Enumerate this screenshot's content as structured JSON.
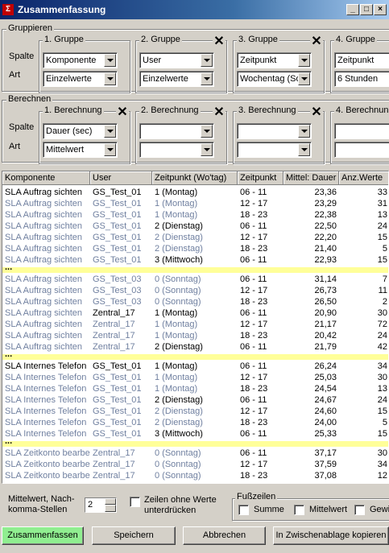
{
  "window": {
    "title": "Zusammenfassung",
    "icon": "app-icon",
    "controls": [
      "_",
      "□",
      "×"
    ]
  },
  "gruppieren": {
    "title": "Gruppieren",
    "row_labels": [
      "Spalte",
      "Art"
    ],
    "groups": [
      {
        "title": "1. Gruppe",
        "spalte": "Komponente",
        "art": "Einzelwerte"
      },
      {
        "title": "2. Gruppe",
        "spalte": "User",
        "art": "Einzelwerte"
      },
      {
        "title": "3. Gruppe",
        "spalte": "Zeitpunkt",
        "art": "Wochentag (So"
      },
      {
        "title": "4. Gruppe",
        "spalte": "Zeitpunkt",
        "art": "6 Stunden"
      }
    ]
  },
  "berechnen": {
    "title": "Berechnen",
    "row_labels": [
      "Spalte",
      "Art"
    ],
    "groups": [
      {
        "title": "1. Berechnung",
        "spalte": "Dauer (sec)",
        "art": "Mittelwert"
      },
      {
        "title": "2. Berechnung",
        "spalte": "",
        "art": ""
      },
      {
        "title": "3. Berechnung",
        "spalte": "",
        "art": ""
      },
      {
        "title": "4. Berechnun",
        "spalte": "",
        "art": ""
      }
    ]
  },
  "table": {
    "columns": [
      "Komponente",
      "User",
      "Zeitpunkt (Wo'tag)",
      "Zeitpunkt",
      "Mittel: Dauer",
      "Anz.Werte"
    ],
    "rows": [
      {
        "c": [
          "SLA Auftrag sichten",
          "GS_Test_01",
          "1 (Montag)",
          "06 - 11",
          "23,36",
          "33"
        ],
        "b": [
          1,
          1,
          1,
          1,
          1,
          1
        ]
      },
      {
        "c": [
          "SLA Auftrag sichten",
          "GS_Test_01",
          "1 (Montag)",
          "12 - 17",
          "23,29",
          "31"
        ],
        "b": [
          0,
          0,
          0,
          1,
          1,
          1
        ]
      },
      {
        "c": [
          "SLA Auftrag sichten",
          "GS_Test_01",
          "1 (Montag)",
          "18 - 23",
          "22,38",
          "13"
        ],
        "b": [
          0,
          0,
          0,
          1,
          1,
          1
        ]
      },
      {
        "c": [
          "SLA Auftrag sichten",
          "GS_Test_01",
          "2 (Dienstag)",
          "06 - 11",
          "22,50",
          "24"
        ],
        "b": [
          0,
          0,
          1,
          1,
          1,
          1
        ]
      },
      {
        "c": [
          "SLA Auftrag sichten",
          "GS_Test_01",
          "2 (Dienstag)",
          "12 - 17",
          "22,20",
          "15"
        ],
        "b": [
          0,
          0,
          0,
          1,
          1,
          1
        ]
      },
      {
        "c": [
          "SLA Auftrag sichten",
          "GS_Test_01",
          "2 (Dienstag)",
          "18 - 23",
          "21,40",
          "5"
        ],
        "b": [
          0,
          0,
          0,
          1,
          1,
          1
        ]
      },
      {
        "c": [
          "SLA Auftrag sichten",
          "GS_Test_01",
          "3 (Mittwoch)",
          "06 - 11",
          "22,93",
          "15"
        ],
        "b": [
          0,
          0,
          1,
          1,
          1,
          1
        ]
      },
      {
        "sep": true,
        "label": "..."
      },
      {
        "c": [
          "SLA Auftrag sichten",
          "GS_Test_03",
          "0 (Sonntag)",
          "06 - 11",
          "31,14",
          "7"
        ],
        "b": [
          0,
          0,
          0,
          1,
          1,
          1
        ]
      },
      {
        "c": [
          "SLA Auftrag sichten",
          "GS_Test_03",
          "0 (Sonntag)",
          "12 - 17",
          "26,73",
          "11"
        ],
        "b": [
          0,
          0,
          0,
          1,
          1,
          1
        ]
      },
      {
        "c": [
          "SLA Auftrag sichten",
          "GS_Test_03",
          "0 (Sonntag)",
          "18 - 23",
          "26,50",
          "2"
        ],
        "b": [
          0,
          0,
          0,
          1,
          1,
          1
        ]
      },
      {
        "c": [
          "SLA Auftrag sichten",
          "Zentral_17",
          "1 (Montag)",
          "06 - 11",
          "20,90",
          "30"
        ],
        "b": [
          0,
          1,
          1,
          1,
          1,
          1
        ]
      },
      {
        "c": [
          "SLA Auftrag sichten",
          "Zentral_17",
          "1 (Montag)",
          "12 - 17",
          "21,17",
          "72"
        ],
        "b": [
          0,
          0,
          0,
          1,
          1,
          1
        ]
      },
      {
        "c": [
          "SLA Auftrag sichten",
          "Zentral_17",
          "1 (Montag)",
          "18 - 23",
          "20,42",
          "24"
        ],
        "b": [
          0,
          0,
          0,
          1,
          1,
          1
        ]
      },
      {
        "c": [
          "SLA Auftrag sichten",
          "Zentral_17",
          "2 (Dienstag)",
          "06 - 11",
          "21,79",
          "42"
        ],
        "b": [
          0,
          0,
          1,
          1,
          1,
          1
        ]
      },
      {
        "sep": true,
        "label": "..."
      },
      {
        "c": [
          "SLA Internes Telefon",
          "GS_Test_01",
          "1 (Montag)",
          "06 - 11",
          "26,24",
          "34"
        ],
        "b": [
          1,
          1,
          1,
          1,
          1,
          1
        ]
      },
      {
        "c": [
          "SLA Internes Telefon",
          "GS_Test_01",
          "1 (Montag)",
          "12 - 17",
          "25,03",
          "30"
        ],
        "b": [
          0,
          0,
          0,
          1,
          1,
          1
        ]
      },
      {
        "c": [
          "SLA Internes Telefon",
          "GS_Test_01",
          "1 (Montag)",
          "18 - 23",
          "24,54",
          "13"
        ],
        "b": [
          0,
          0,
          0,
          1,
          1,
          1
        ]
      },
      {
        "c": [
          "SLA Internes Telefon",
          "GS_Test_01",
          "2 (Dienstag)",
          "06 - 11",
          "24,67",
          "24"
        ],
        "b": [
          0,
          0,
          1,
          1,
          1,
          1
        ]
      },
      {
        "c": [
          "SLA Internes Telefon",
          "GS_Test_01",
          "2 (Dienstag)",
          "12 - 17",
          "24,60",
          "15"
        ],
        "b": [
          0,
          0,
          0,
          1,
          1,
          1
        ]
      },
      {
        "c": [
          "SLA Internes Telefon",
          "GS_Test_01",
          "2 (Dienstag)",
          "18 - 23",
          "24,00",
          "5"
        ],
        "b": [
          0,
          0,
          0,
          1,
          1,
          1
        ]
      },
      {
        "c": [
          "SLA Internes Telefon",
          "GS_Test_01",
          "3 (Mittwoch)",
          "06 - 11",
          "25,33",
          "15"
        ],
        "b": [
          0,
          0,
          1,
          1,
          1,
          1
        ]
      },
      {
        "sep": true,
        "label": "..."
      },
      {
        "c": [
          "SLA Zeitkonto bearbe",
          "Zentral_17",
          "0 (Sonntag)",
          "06 - 11",
          "37,17",
          "30"
        ],
        "b": [
          0,
          0,
          0,
          1,
          1,
          1
        ]
      },
      {
        "c": [
          "SLA Zeitkonto bearbe",
          "Zentral_17",
          "0 (Sonntag)",
          "12 - 17",
          "37,59",
          "34"
        ],
        "b": [
          0,
          0,
          0,
          1,
          1,
          1
        ]
      },
      {
        "c": [
          "SLA Zeitkonto bearbe",
          "Zentral_17",
          "0 (Sonntag)",
          "18 - 23",
          "37,08",
          "12"
        ],
        "b": [
          0,
          0,
          0,
          1,
          1,
          1
        ]
      }
    ]
  },
  "bottom": {
    "decimals_label_1": "Mittelwert, Nach-",
    "decimals_label_2": "komma-Stellen",
    "decimals_value": "2",
    "suppress_label_1": "Zeilen ohne Werte",
    "suppress_label_2": "unterdrücken",
    "footer_title": "Fußzeilen",
    "footer_options": [
      "Summe",
      "Mittelwert",
      "Gewi"
    ]
  },
  "buttons": {
    "summarize": "Zusammenfassen",
    "save": "Speichern",
    "cancel": "Abbrechen",
    "clipboard": "In Zwischenablage kopieren"
  },
  "colors": {
    "titlebar": "#0a246a",
    "highlight_row": "#ffff99",
    "dim_text": "#7080a0",
    "green_button": "#90ee90"
  }
}
